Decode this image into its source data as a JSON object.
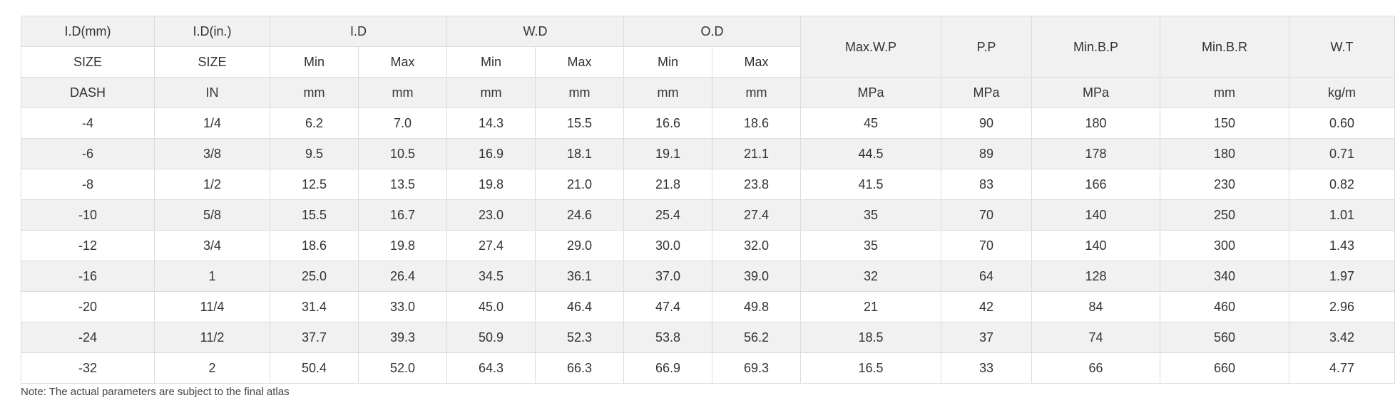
{
  "table": {
    "header1": {
      "id_mm": "I.D(mm)",
      "id_in": "I.D(in.)",
      "id": "I.D",
      "wd": "W.D",
      "od": "O.D",
      "max_wp": "Max.W.P",
      "pp": "P.P",
      "min_bp": "Min.B.P",
      "min_br": "Min.B.R",
      "wt": "W.T"
    },
    "header2": [
      "SIZE",
      "SIZE",
      "Min",
      "Max",
      "Min",
      "Max",
      "Min",
      "Max"
    ],
    "header3": [
      "DASH",
      "IN",
      "mm",
      "mm",
      "mm",
      "mm",
      "mm",
      "mm",
      "MPa",
      "MPa",
      "MPa",
      "mm",
      "kg/m"
    ],
    "rows": [
      [
        "-4",
        "1/4",
        "6.2",
        "7.0",
        "14.3",
        "15.5",
        "16.6",
        "18.6",
        "45",
        "90",
        "180",
        "150",
        "0.60"
      ],
      [
        "-6",
        "3/8",
        "9.5",
        "10.5",
        "16.9",
        "18.1",
        "19.1",
        "21.1",
        "44.5",
        "89",
        "178",
        "180",
        "0.71"
      ],
      [
        "-8",
        "1/2",
        "12.5",
        "13.5",
        "19.8",
        "21.0",
        "21.8",
        "23.8",
        "41.5",
        "83",
        "166",
        "230",
        "0.82"
      ],
      [
        "-10",
        "5/8",
        "15.5",
        "16.7",
        "23.0",
        "24.6",
        "25.4",
        "27.4",
        "35",
        "70",
        "140",
        "250",
        "1.01"
      ],
      [
        "-12",
        "3/4",
        "18.6",
        "19.8",
        "27.4",
        "29.0",
        "30.0",
        "32.0",
        "35",
        "70",
        "140",
        "300",
        "1.43"
      ],
      [
        "-16",
        "1",
        "25.0",
        "26.4",
        "34.5",
        "36.1",
        "37.0",
        "39.0",
        "32",
        "64",
        "128",
        "340",
        "1.97"
      ],
      [
        "-20",
        "11/4",
        "31.4",
        "33.0",
        "45.0",
        "46.4",
        "47.4",
        "49.8",
        "21",
        "42",
        "84",
        "460",
        "2.96"
      ],
      [
        "-24",
        "11/2",
        "37.7",
        "39.3",
        "50.9",
        "52.3",
        "53.8",
        "56.2",
        "18.5",
        "37",
        "74",
        "560",
        "3.42"
      ],
      [
        "-32",
        "2",
        "50.4",
        "52.0",
        "64.3",
        "66.3",
        "66.9",
        "69.3",
        "16.5",
        "33",
        "66",
        "660",
        "4.77"
      ]
    ]
  },
  "note": "Note: The actual parameters are subject to the final atlas"
}
